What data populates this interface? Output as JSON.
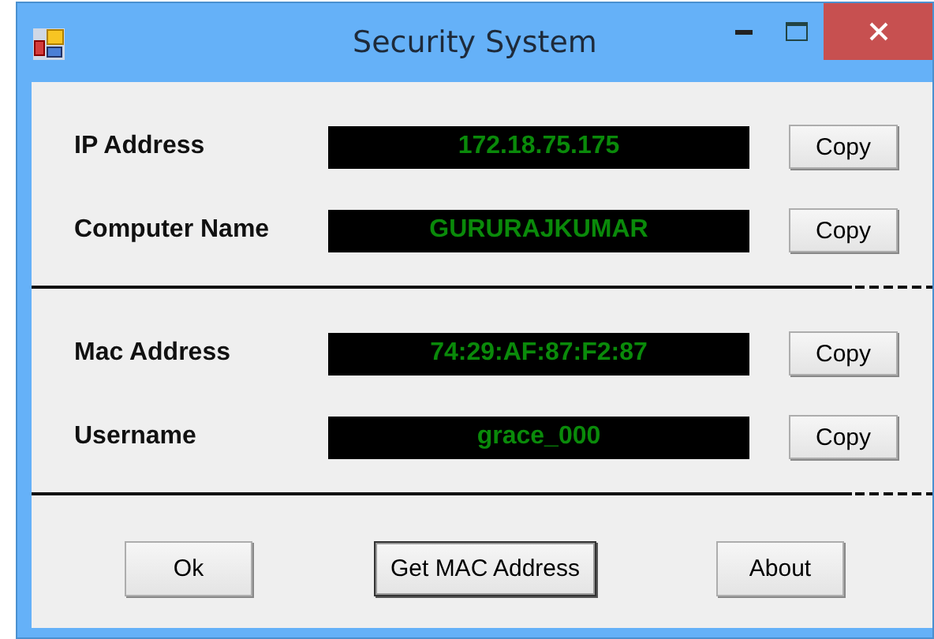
{
  "window": {
    "title": "Security System"
  },
  "sections": [
    {
      "fields": [
        {
          "label": "IP Address",
          "value": "172.18.75.175",
          "button": "Copy"
        },
        {
          "label": "Computer Name",
          "value": "GURURAJKUMAR",
          "button": "Copy"
        }
      ]
    },
    {
      "fields": [
        {
          "label": "Mac Address",
          "value": "74:29:AF:87:F2:87",
          "button": "Copy"
        },
        {
          "label": "Username",
          "value": "grace_000",
          "button": "Copy"
        }
      ]
    }
  ],
  "buttons": [
    {
      "label": "Ok",
      "default": false
    },
    {
      "label": "Get MAC Address",
      "default": true
    },
    {
      "label": "About",
      "default": false
    }
  ]
}
